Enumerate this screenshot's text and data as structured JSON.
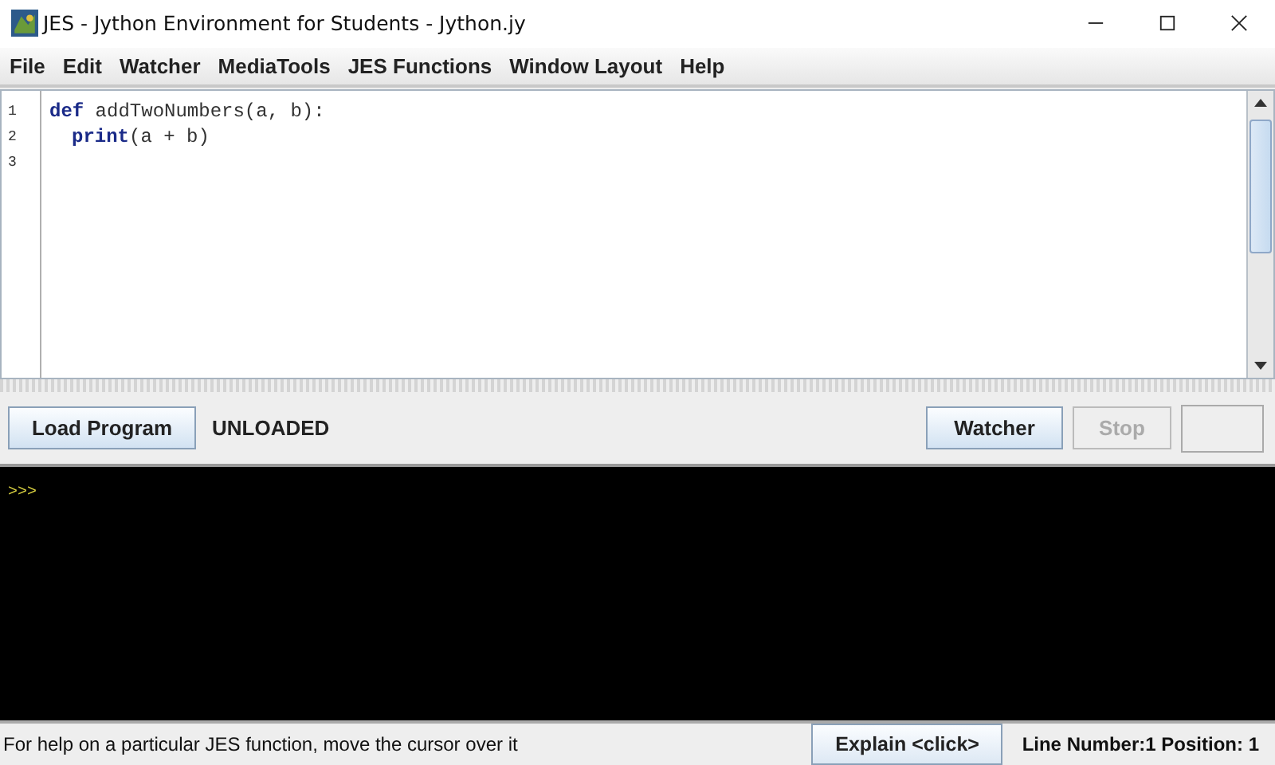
{
  "window": {
    "title": "JES - Jython Environment for Students - Jython.jy"
  },
  "menu": [
    "File",
    "Edit",
    "Watcher",
    "MediaTools",
    "JES Functions",
    "Window Layout",
    "Help"
  ],
  "editor": {
    "lines": [
      {
        "number": "1",
        "tokens": [
          {
            "kind": "keyword",
            "text": "def"
          },
          {
            "kind": "plain",
            "text": " addTwoNumbers(a, b):"
          }
        ],
        "children": [
          {
            "number": "2",
            "tokens": [
              {
                "kind": "keyword",
                "text": "print"
              },
              {
                "kind": "plain",
                "text": "(a + b)"
              }
            ]
          }
        ]
      },
      {
        "number": "3"
      }
    ]
  },
  "controls": {
    "load_button": "Load Program",
    "status": "UNLOADED",
    "buttons": [
      {
        "label": "Watcher",
        "disabled": false
      },
      {
        "label": "Stop",
        "disabled": true
      }
    ]
  },
  "console": {
    "prompt": ">>>"
  },
  "status_bar": {
    "help": "For help on a particular JES function, move the cursor over it",
    "explain_button": "Explain <click>",
    "position": "Line Number:1 Position: 1"
  }
}
